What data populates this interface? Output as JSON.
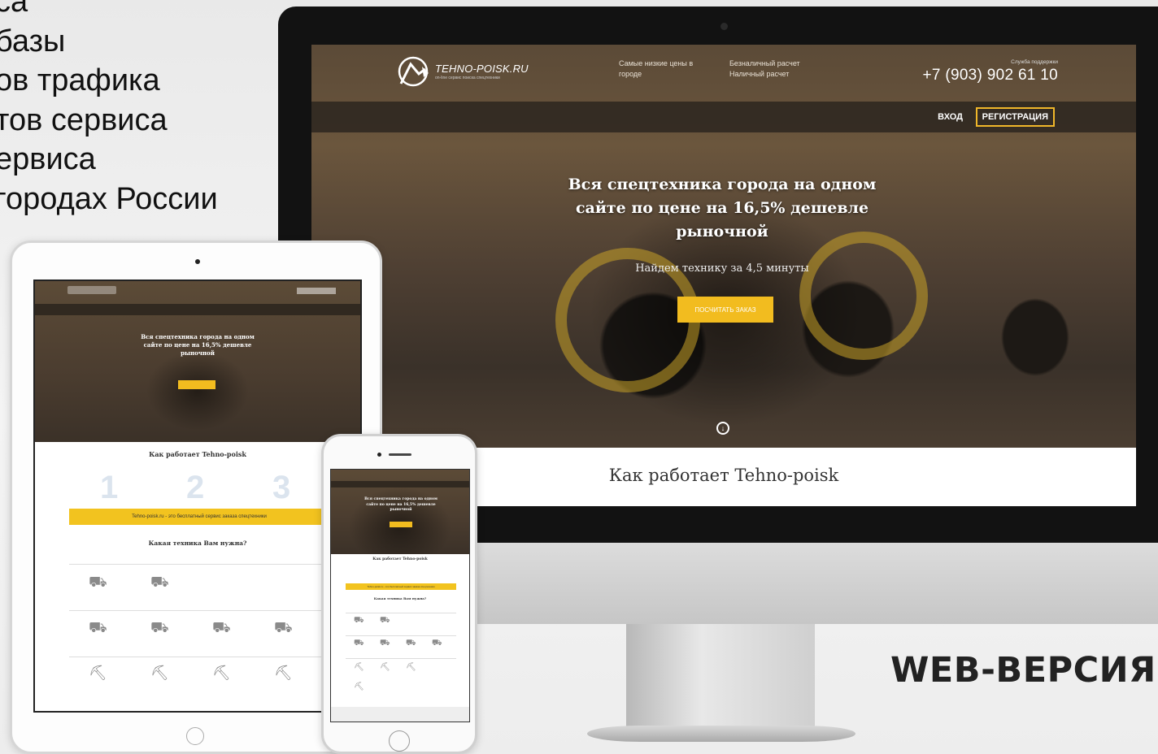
{
  "left_text": {
    "lines": [
      "са",
      "базы",
      "ов трафика",
      "тов сервиса",
      "ервиса",
      "городах России"
    ]
  },
  "desktop": {
    "logo": {
      "name": "TEHNO-POISK.RU",
      "tagline": "on-line сервис поиска спецтехники"
    },
    "header_info_1": {
      "line1": "Самые низкие цены в",
      "line2": "городе"
    },
    "header_info_2": {
      "line1": "Безналичный расчет",
      "line2": "Наличный расчет"
    },
    "support_label": "Служба поддержки",
    "phone": "+7 (903) 902 61 10",
    "nav": {
      "login": "ВХОД",
      "register": "РЕГИСТРАЦИЯ"
    },
    "hero": {
      "title": "Вся спецтехника города на одном сайте по цене на 16,5% дешевле рыночной",
      "subtitle": "Найдем технику за 4,5 минуты",
      "cta": "ПОСЧИТАТЬ ЗАКАЗ"
    },
    "how_title": "Как работает Tehno-poisk",
    "accent_color": "#f2bc1f"
  },
  "tablet": {
    "how_title": "Как работает Tehno-poisk",
    "steps": [
      "1",
      "2",
      "3"
    ],
    "band_text": "Tehno-poisk.ru - это бесплатный сервис заказа спецтехники",
    "question": "Какая техника Вам нужна?"
  },
  "label": "WEB-ВЕРСИЯ",
  "icons": {
    "logo": "excavator-logo-icon",
    "scroll": "scroll-down-icon"
  }
}
